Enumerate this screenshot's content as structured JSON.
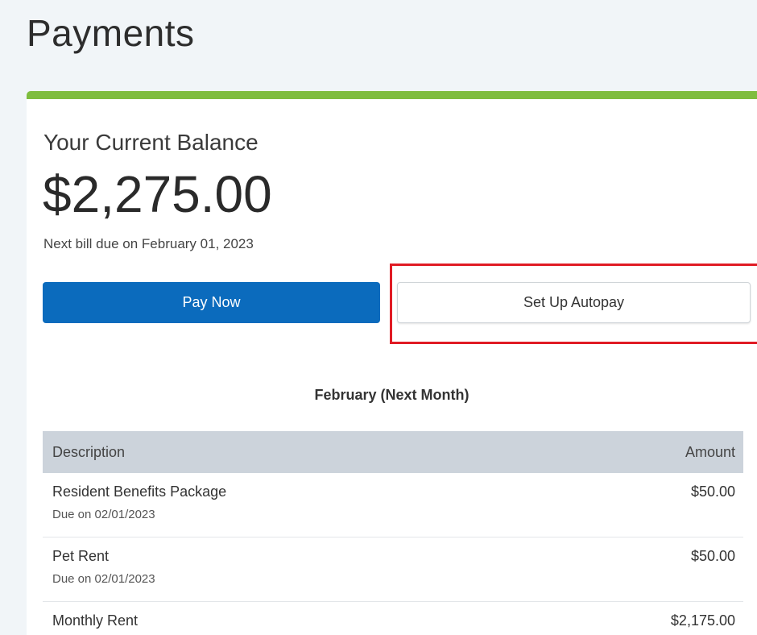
{
  "page": {
    "title": "Payments"
  },
  "balance": {
    "label": "Your Current Balance",
    "amount": "$2,275.00",
    "due_text": "Next bill due on February 01, 2023"
  },
  "actions": {
    "pay_now_label": "Pay Now",
    "autopay_label": "Set Up Autopay"
  },
  "schedule": {
    "title": "February (Next Month)",
    "columns": {
      "description": "Description",
      "amount": "Amount"
    },
    "rows": [
      {
        "name": "Resident Benefits Package",
        "due": "Due on 02/01/2023",
        "amount": "$50.00"
      },
      {
        "name": "Pet Rent",
        "due": "Due on 02/01/2023",
        "amount": "$50.00"
      },
      {
        "name": "Monthly Rent",
        "due": "",
        "amount": "$2,175.00"
      }
    ]
  },
  "colors": {
    "accent_bar": "#7fbd3f",
    "primary_button": "#0b6bbd",
    "highlight": "#e01b24",
    "table_header": "#ccd3db"
  }
}
